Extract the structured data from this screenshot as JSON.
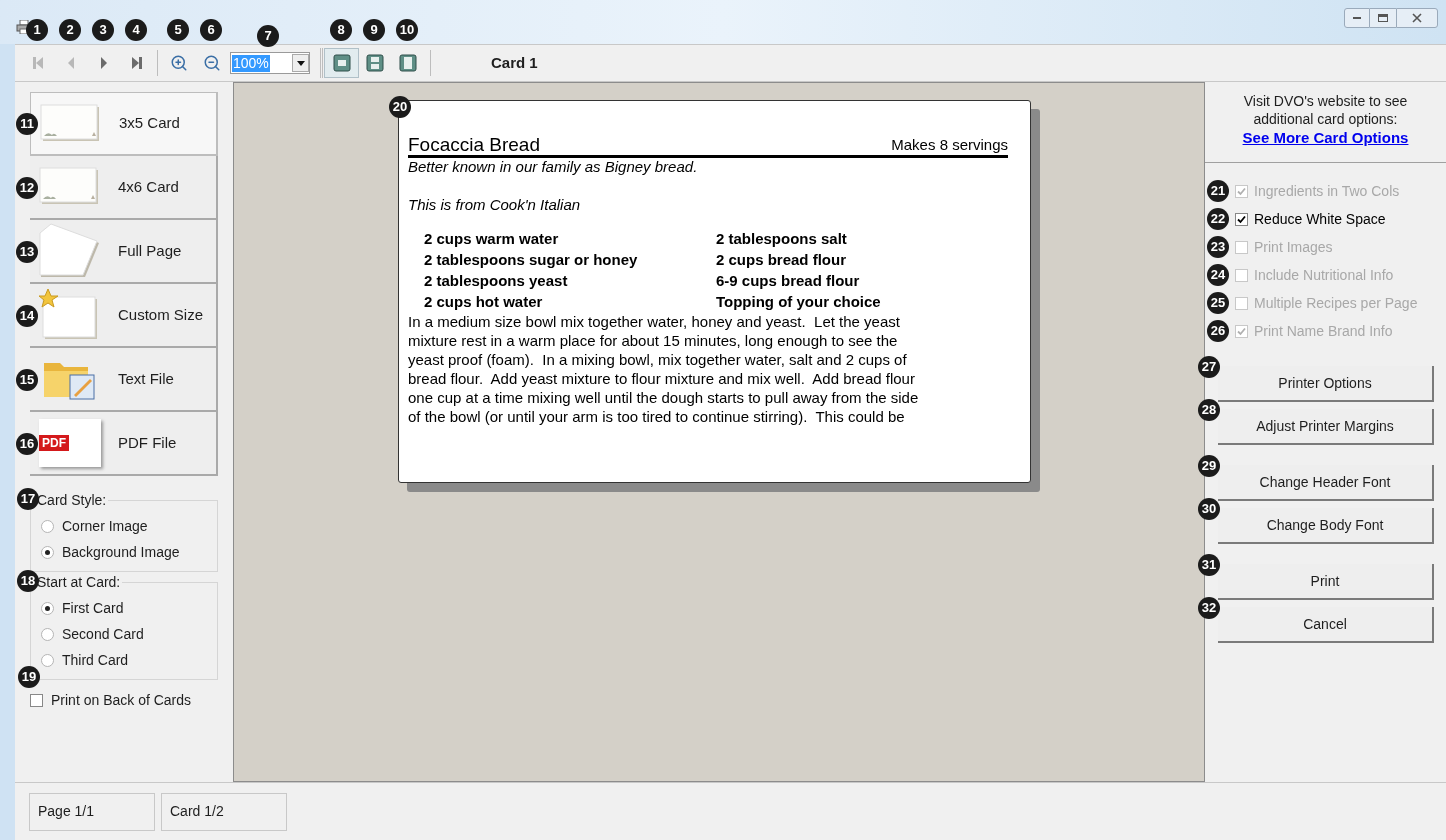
{
  "toolbar": {
    "buttons": [
      {
        "kind": "first",
        "callout": "1",
        "disabled": true
      },
      {
        "kind": "previous",
        "callout": "2",
        "disabled": true
      },
      {
        "kind": "next",
        "callout": "3",
        "disabled": false
      },
      {
        "kind": "last",
        "callout": "4",
        "disabled": false
      },
      {
        "kind": "zoom-in",
        "callout": "5",
        "disabled": false
      },
      {
        "kind": "zoom-out",
        "callout": "6",
        "disabled": false
      }
    ],
    "zoom": {
      "value": "100%",
      "callout": "7"
    },
    "views": [
      {
        "kind": "one",
        "callout": "8",
        "selected": true
      },
      {
        "kind": "two",
        "callout": "9",
        "selected": false
      },
      {
        "kind": "page",
        "callout": "10",
        "selected": false
      }
    ],
    "card_label": "Card 1"
  },
  "card_types": [
    {
      "kind": "card",
      "label": "3x5 Card",
      "callout": "11",
      "selected": true
    },
    {
      "kind": "card",
      "label": "4x6 Card",
      "callout": "12",
      "selected": false
    },
    {
      "kind": "page",
      "label": "Full Page",
      "callout": "13",
      "selected": false
    },
    {
      "kind": "custom",
      "label": "Custom Size",
      "callout": "14",
      "selected": false
    },
    {
      "kind": "text",
      "label": "Text File",
      "callout": "15",
      "selected": false
    },
    {
      "kind": "pdf",
      "label": "PDF File",
      "badge": "PDF",
      "callout": "16",
      "selected": false
    }
  ],
  "card_style": {
    "title": "Card Style:",
    "callout": "17",
    "options": [
      {
        "label": "Corner Image",
        "selected": false
      },
      {
        "label": "Background Image",
        "selected": true
      }
    ]
  },
  "start_at_card": {
    "title": "Start at Card:",
    "callout": "18",
    "options": [
      {
        "label": "First Card",
        "selected": true
      },
      {
        "label": "Second Card",
        "selected": false
      },
      {
        "label": "Third Card",
        "selected": false
      }
    ]
  },
  "print_on_back": {
    "label": "Print on Back of Cards",
    "checked": false,
    "callout": "19"
  },
  "preview": {
    "callout": "20",
    "title": "Focaccia Bread",
    "servings": "Makes 8 servings",
    "notes": [
      "Better known in our family as Bigney bread.",
      "This is from Cook'n Italian"
    ],
    "ingredients": [
      [
        "2 cups warm water",
        "2 tablespoons sugar or honey",
        "2 tablespoons yeast",
        "2 cups hot water"
      ],
      [
        "2 tablespoons salt",
        "2 cups bread flour",
        "6-9 cups bread flour",
        "Topping of your choice"
      ]
    ],
    "directions": [
      "In a medium size bowl mix together water, honey and yeast.  Let the yeast",
      "mixture rest in a warm place for about 15 minutes, long enough to see the",
      "yeast proof (foam).  In a mixing bowl, mix together water, salt and 2 cups of",
      "bread flour.  Add yeast mixture to flour mixture and mix well.  Add bread flour",
      "one cup at a time mixing well until the dough starts to pull away from the side",
      "of the bowl (or until your arm is too tired to continue stirring).  This could be"
    ]
  },
  "website": {
    "text": "Visit DVO's website to see additional card options:",
    "link": "See More Card Options"
  },
  "options": [
    {
      "label": "Ingredients in Two Cols",
      "checked": true,
      "disabled": true,
      "callout": "21"
    },
    {
      "label": "Reduce White Space",
      "checked": true,
      "disabled": false,
      "callout": "22"
    },
    {
      "label": "Print Images",
      "checked": false,
      "disabled": true,
      "callout": "23"
    },
    {
      "label": "Include Nutritional Info",
      "checked": false,
      "disabled": true,
      "callout": "24"
    },
    {
      "label": "Multiple Recipes per Page",
      "checked": false,
      "disabled": true,
      "callout": "25"
    },
    {
      "label": "Print Name Brand Info",
      "checked": true,
      "disabled": true,
      "callout": "26"
    }
  ],
  "button_groups": [
    [
      {
        "label": "Printer Options",
        "callout": "27"
      },
      {
        "label": "Adjust Printer Margins",
        "callout": "28"
      }
    ],
    [
      {
        "label": "Change Header Font",
        "callout": "29"
      },
      {
        "label": "Change Body Font",
        "callout": "30"
      }
    ],
    [
      {
        "label": "Print",
        "callout": "31"
      },
      {
        "label": "Cancel",
        "callout": "32"
      }
    ]
  ],
  "status_bar": [
    "Page 1/1",
    "Card 1/2"
  ]
}
